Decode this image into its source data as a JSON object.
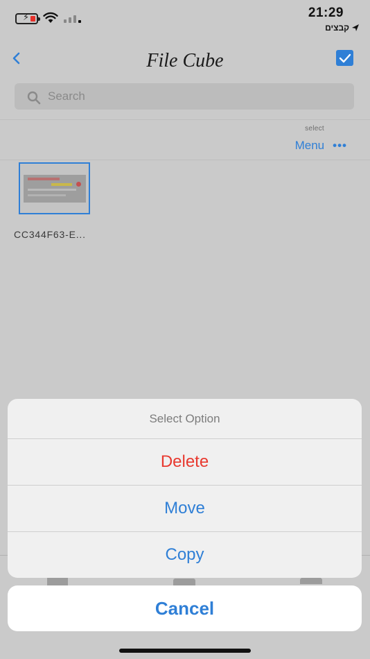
{
  "status_bar": {
    "time": "21:29",
    "carrier": "קבצים",
    "battery_state": "charging-low"
  },
  "nav": {
    "title": "File Cube",
    "back_icon": "chevron-left-icon",
    "select_all_icon": "checkbox-checked-icon"
  },
  "search": {
    "placeholder": "Search"
  },
  "toolbar": {
    "select_label": "select",
    "menu_label": "Menu",
    "more_glyph": "•••"
  },
  "files": [
    {
      "name": "CC344F63-E..."
    }
  ],
  "action_sheet": {
    "title": "Select Option",
    "options": [
      {
        "label": "Delete",
        "style": "destructive"
      },
      {
        "label": "Move",
        "style": "default"
      },
      {
        "label": "Copy",
        "style": "default"
      }
    ],
    "cancel_label": "Cancel"
  },
  "colors": {
    "accent": "#2f7fd6",
    "destructive": "#e8392f",
    "dim_overlay": "#cacaca"
  }
}
